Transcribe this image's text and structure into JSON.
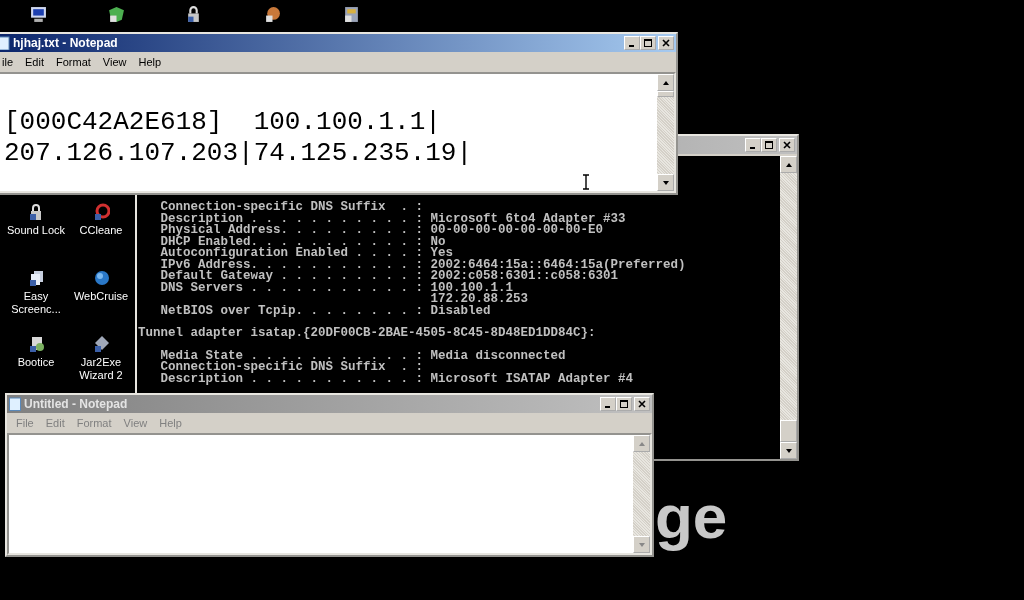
{
  "desktop_icons": [
    {
      "label": "Sound Lock",
      "kind": "lock"
    },
    {
      "label": "CCleane",
      "kind": "cleaner"
    },
    {
      "label": "Easy Screenc...",
      "kind": "screens"
    },
    {
      "label": "WebCruise",
      "kind": "globe"
    },
    {
      "label": "Bootice",
      "kind": "boot"
    },
    {
      "label": "Jar2Exe Wizard 2",
      "kind": "jar"
    }
  ],
  "wallpaper_text": "ge",
  "console": {
    "active": false,
    "lines": [
      {
        "kind": "entry",
        "text": "   Connection-specific DNS Suffix  . :"
      },
      {
        "kind": "entry",
        "text": "   Description . . . . . . . . . . . : Microsoft 6to4 Adapter #33"
      },
      {
        "kind": "entry",
        "text": "   Physical Address. . . . . . . . . : 00-00-00-00-00-00-00-E0"
      },
      {
        "kind": "entry",
        "text": "   DHCP Enabled. . . . . . . . . . . : No"
      },
      {
        "kind": "entry",
        "text": "   Autoconfiguration Enabled . . . . : Yes"
      },
      {
        "kind": "entry",
        "text": "   IPv6 Address. . . . . . . . . . . : 2002:6464:15a::6464:15a(Preferred)"
      },
      {
        "kind": "entry",
        "text": "   Default Gateway . . . . . . . . . : 2002:c058:6301::c058:6301"
      },
      {
        "kind": "entry",
        "text": "   DNS Servers . . . . . . . . . . . : 100.100.1.1"
      },
      {
        "kind": "entry",
        "text": "                                       172.20.88.253"
      },
      {
        "kind": "entry",
        "text": "   NetBIOS over Tcpip. . . . . . . . : Disabled"
      },
      {
        "kind": "header",
        "text": "Tunnel adapter isatap.{20DF00CB-2BAE-4505-8C45-8D48ED1DD84C}:"
      },
      {
        "kind": "entry",
        "text": "   Media State . . . . . . . . . . . : Media disconnected"
      },
      {
        "kind": "entry",
        "text": "   Connection-specific DNS Suffix  . :"
      },
      {
        "kind": "entry",
        "text": "   Description . . . . . . . . . . . : Microsoft ISATAP Adapter #4"
      }
    ]
  },
  "notepad_front": {
    "title": "hjhaj.txt - Notepad",
    "active": true,
    "menu": [
      "ile",
      "Edit",
      "Format",
      "View",
      "Help"
    ],
    "lines": [
      "[000C42A2E618]  100.100.1.1|",
      "207.126.107.203|74.125.235.19|"
    ]
  },
  "notepad_back": {
    "title": "Untitled - Notepad",
    "active": false,
    "menu": [
      "File",
      "Edit",
      "Format",
      "View",
      "Help"
    ]
  }
}
